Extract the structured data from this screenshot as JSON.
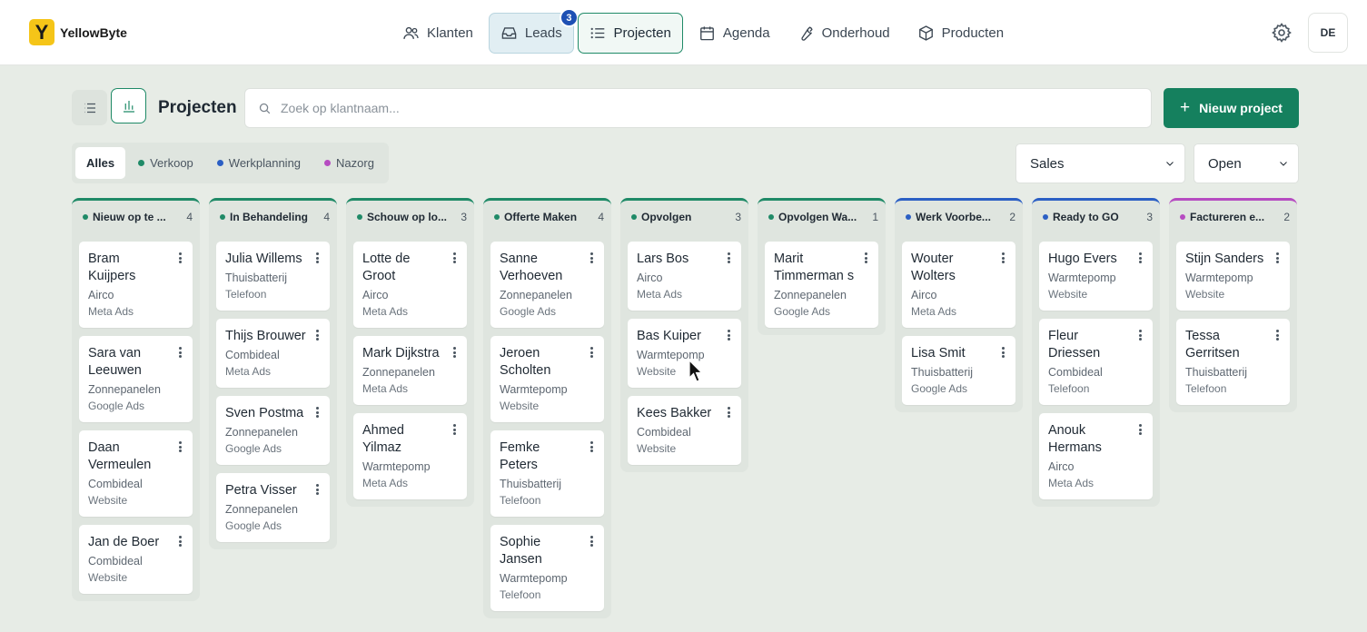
{
  "app": {
    "logo_letter": "Y",
    "logo_text": "YellowByte",
    "avatar_initials": "DE"
  },
  "nav": {
    "klanten": "Klanten",
    "leads": "Leads",
    "leads_badge": "3",
    "projecten": "Projecten",
    "agenda": "Agenda",
    "onderhoud": "Onderhoud",
    "producten": "Producten"
  },
  "toolbar": {
    "title": "Projecten",
    "search_placeholder": "Zoek op klantnaam...",
    "new_button": "Nieuw project",
    "new_button_icon": "+"
  },
  "filters": {
    "all": "Alles",
    "verkoop": "Verkoop",
    "werkplanning": "Werkplanning",
    "nazorg": "Nazorg",
    "sales_select": "Sales",
    "status_select": "Open"
  },
  "colors": {
    "green": "#1f8a67",
    "blue": "#2b5fc4",
    "purple": "#b64cc1",
    "primary_button": "#15805e"
  },
  "columns": [
    {
      "title": "Nieuw op te ...",
      "count": "4",
      "color": "#1f8a67",
      "cards": [
        {
          "name": "Bram Kuijpers",
          "type": "Airco",
          "source": "Meta Ads"
        },
        {
          "name": "Sara van Leeuwen",
          "type": "Zonnepanelen",
          "source": "Google Ads"
        },
        {
          "name": "Daan Vermeulen",
          "type": "Combideal",
          "source": "Website"
        },
        {
          "name": "Jan de Boer",
          "type": "Combideal",
          "source": "Website"
        }
      ]
    },
    {
      "title": "In Behandeling",
      "count": "4",
      "color": "#1f8a67",
      "cards": [
        {
          "name": "Julia Willems",
          "type": "Thuisbatterij",
          "source": "Telefoon"
        },
        {
          "name": "Thijs Brouwer",
          "type": "Combideal",
          "source": "Meta Ads"
        },
        {
          "name": "Sven Postma",
          "type": "Zonnepanelen",
          "source": "Google Ads"
        },
        {
          "name": "Petra Visser",
          "type": "Zonnepanelen",
          "source": "Google Ads"
        }
      ]
    },
    {
      "title": "Schouw op lo...",
      "count": "3",
      "color": "#1f8a67",
      "cards": [
        {
          "name": "Lotte de Groot",
          "type": "Airco",
          "source": "Meta Ads"
        },
        {
          "name": "Mark Dijkstra",
          "type": "Zonnepanelen",
          "source": "Meta Ads"
        },
        {
          "name": "Ahmed Yilmaz",
          "type": "Warmtepomp",
          "source": "Meta Ads"
        }
      ]
    },
    {
      "title": "Offerte Maken",
      "count": "4",
      "color": "#1f8a67",
      "cards": [
        {
          "name": "Sanne Verhoeven",
          "type": "Zonnepanelen",
          "source": "Google Ads"
        },
        {
          "name": "Jeroen Scholten",
          "type": "Warmtepomp",
          "source": "Website"
        },
        {
          "name": "Femke Peters",
          "type": "Thuisbatterij",
          "source": "Telefoon"
        },
        {
          "name": "Sophie Jansen",
          "type": "Warmtepomp",
          "source": "Telefoon"
        }
      ]
    },
    {
      "title": "Opvolgen",
      "count": "3",
      "color": "#1f8a67",
      "cards": [
        {
          "name": "Lars Bos",
          "type": "Airco",
          "source": "Meta Ads"
        },
        {
          "name": "Bas Kuiper",
          "type": "Warmtepomp",
          "source": "Website"
        },
        {
          "name": "Kees Bakker",
          "type": "Combideal",
          "source": "Website"
        }
      ]
    },
    {
      "title": "Opvolgen Wa...",
      "count": "1",
      "color": "#1f8a67",
      "cards": [
        {
          "name": "Marit Timmerman s",
          "type": "Zonnepanelen",
          "source": "Google Ads"
        }
      ]
    },
    {
      "title": "Werk Voorbe...",
      "count": "2",
      "color": "#2b5fc4",
      "cards": [
        {
          "name": "Wouter Wolters",
          "type": "Airco",
          "source": "Meta Ads"
        },
        {
          "name": "Lisa Smit",
          "type": "Thuisbatterij",
          "source": "Google Ads"
        }
      ]
    },
    {
      "title": "Ready to GO",
      "count": "3",
      "color": "#2b5fc4",
      "cards": [
        {
          "name": "Hugo Evers",
          "type": "Warmtepomp",
          "source": "Website"
        },
        {
          "name": "Fleur Driessen",
          "type": "Combideal",
          "source": "Telefoon"
        },
        {
          "name": "Anouk Hermans",
          "type": "Airco",
          "source": "Meta Ads"
        }
      ]
    },
    {
      "title": "Factureren e...",
      "count": "2",
      "color": "#b64cc1",
      "cards": [
        {
          "name": "Stijn Sanders",
          "type": "Warmtepomp",
          "source": "Website"
        },
        {
          "name": "Tessa Gerritsen",
          "type": "Thuisbatterij",
          "source": "Telefoon"
        }
      ]
    }
  ]
}
